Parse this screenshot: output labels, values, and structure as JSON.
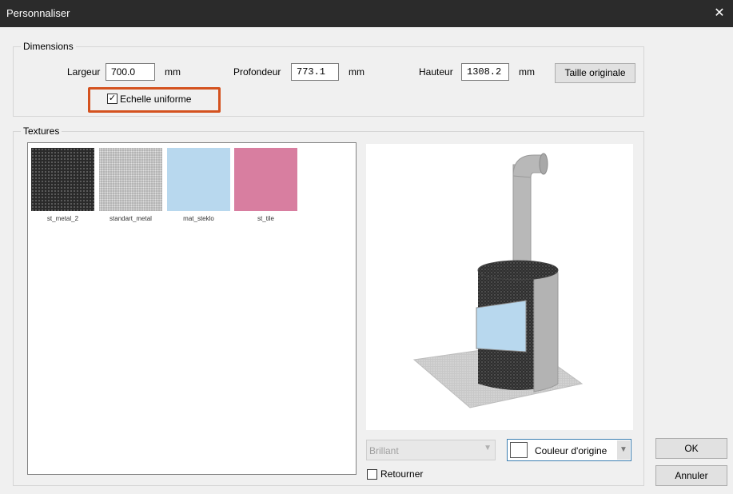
{
  "window": {
    "title": "Personnaliser",
    "close_glyph": "✕"
  },
  "dimensions": {
    "group_label": "Dimensions",
    "width_label": "Largeur",
    "width_value": "700.0",
    "width_unit": "mm",
    "depth_label": "Profondeur",
    "depth_value": "773.1",
    "depth_unit": "mm",
    "height_label": "Hauteur",
    "height_value": "1308.2",
    "height_unit": "mm",
    "original_size_button": "Taille originale",
    "uniform_scale_label": "Echelle uniforme",
    "uniform_scale_checked": true
  },
  "textures": {
    "group_label": "Textures",
    "items": [
      {
        "name": "st_metal_2",
        "color": "#2a2a2a"
      },
      {
        "name": "standart_metal",
        "color": "#b4b4b4"
      },
      {
        "name": "mat_steklo",
        "color": "#b8d8ee"
      },
      {
        "name": "st_tile",
        "color": "#d87ea0"
      }
    ]
  },
  "preview": {
    "finish_select": "Brillant",
    "color_select": "Couleur d'origine",
    "flip_label": "Retourner",
    "flip_checked": false
  },
  "buttons": {
    "ok": "OK",
    "cancel": "Annuler"
  },
  "colors": {
    "titlebar": "#2b2b2b",
    "highlight": "#d4521f",
    "dialog_bg": "#f0f0f0"
  }
}
